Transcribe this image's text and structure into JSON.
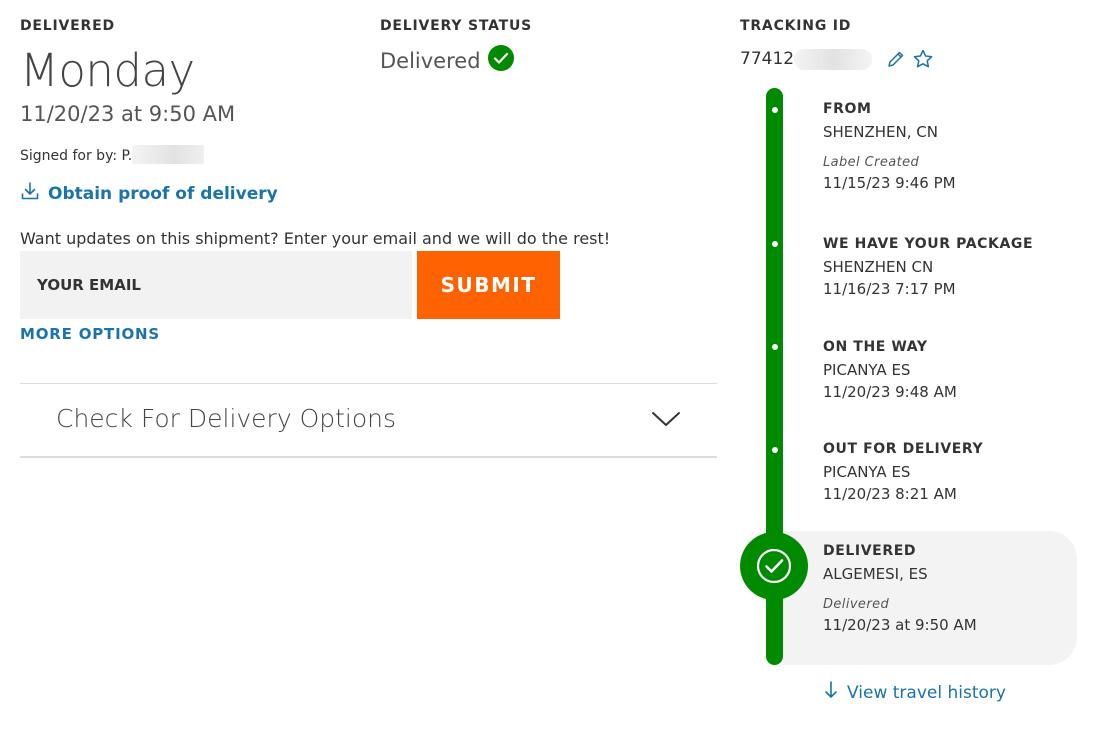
{
  "delivery": {
    "delivered_label": "DELIVERED",
    "day": "Monday",
    "datetime": "11/20/23 at 9:50 AM",
    "signed_prefix": "Signed for by: P.",
    "proof_link": "Obtain proof of delivery"
  },
  "status": {
    "label": "DELIVERY STATUS",
    "value": "Delivered"
  },
  "tracking": {
    "label": "TRACKING ID",
    "id_visible": "77412"
  },
  "updates": {
    "prompt": "Want updates on this shipment? Enter your email and we will do the rest!",
    "email_placeholder": "YOUR EMAIL",
    "submit_label": "SUBMIT",
    "more_options": "MORE OPTIONS"
  },
  "accordion": {
    "title": "Check For Delivery Options"
  },
  "timeline": {
    "events": [
      {
        "title": "FROM",
        "location": "SHENZHEN, CN",
        "status": "Label Created",
        "date": "11/15/23 9:46 PM"
      },
      {
        "title": "WE HAVE YOUR PACKAGE",
        "location": "SHENZHEN CN",
        "date": "11/16/23 7:17 PM"
      },
      {
        "title": "ON THE WAY",
        "location": "PICANYA ES",
        "date": "11/20/23 9:48 AM"
      },
      {
        "title": "OUT FOR DELIVERY",
        "location": "PICANYA ES",
        "date": "11/20/23 8:21 AM"
      },
      {
        "title": "DELIVERED",
        "location": "ALGEMESI, ES",
        "status": "Delivered",
        "date": "11/20/23 at 9:50 AM"
      }
    ],
    "history_link": "View travel history"
  },
  "colors": {
    "accent_blue": "#1a73a9",
    "submit_orange": "#ff6200",
    "success_green": "#008a00"
  },
  "icons": [
    "download-icon",
    "check-circle-icon",
    "pencil-icon",
    "star-icon",
    "chevron-down-icon",
    "arrow-down-icon"
  ]
}
